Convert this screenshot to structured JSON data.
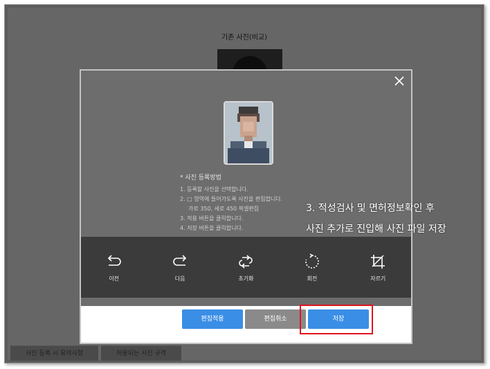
{
  "background": {
    "title": "기존 사진(비교)",
    "tabs": [
      "사진 등록 시 유의사항",
      "허용되는 사진 규격"
    ]
  },
  "modal": {
    "close_icon": "close-icon",
    "instructions": {
      "heading": "* 사진 등록방법",
      "steps": [
        "1. 등록할 사진을 선택합니다.",
        "2. □ 영역에 들어가도록 사진을 편집합니다.",
        "가로 350, 세로 450 픽셀편집",
        "3. 적용 버튼을 클릭합니다.",
        "4. 저장 버튼을 클릭합니다."
      ]
    },
    "tools": [
      {
        "label": "이전",
        "icon": "undo-icon"
      },
      {
        "label": "다음",
        "icon": "redo-icon"
      },
      {
        "label": "초기화",
        "icon": "reset-icon"
      },
      {
        "label": "회전",
        "icon": "rotate-icon"
      },
      {
        "label": "자르기",
        "icon": "crop-icon"
      }
    ],
    "buttons": {
      "apply": "편집적용",
      "cancel": "편집취소",
      "save": "저장"
    }
  },
  "annotation": {
    "line1": "3. 적성검사 및 면허정보확인 후",
    "line2": "사진 추가로 진입해 사진 파일 저장"
  },
  "colors": {
    "primary_button": "#3a8ee6",
    "secondary_button": "#8a8a8a",
    "highlight": "#e0141e"
  }
}
